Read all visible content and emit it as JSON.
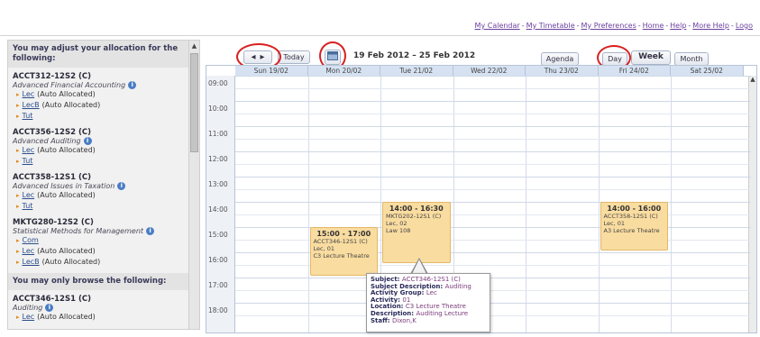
{
  "toplinks": [
    {
      "label": "My Calendar"
    },
    {
      "label": "My Timetable"
    },
    {
      "label": "My Preferences"
    },
    {
      "label": "Home"
    },
    {
      "label": "Help"
    },
    {
      "label": "More Help"
    },
    {
      "label": "Logo"
    }
  ],
  "sidebar": {
    "heading_adjust": "You may adjust your allocation for the following:",
    "heading_browse": "You may only browse the following:",
    "courses": [
      {
        "code": "ACCT312-12S2 (C)",
        "desc": "Advanced Financial Accounting",
        "acts": [
          {
            "link": "Lec",
            "note": "(Auto Allocated)"
          },
          {
            "link": "LecB",
            "note": "(Auto Allocated)"
          },
          {
            "link": "Tut",
            "note": ""
          }
        ]
      },
      {
        "code": "ACCT356-12S2 (C)",
        "desc": "Advanced Auditing",
        "acts": [
          {
            "link": "Lec",
            "note": "(Auto Allocated)"
          },
          {
            "link": "Tut",
            "note": ""
          }
        ]
      },
      {
        "code": "ACCT358-12S1 (C)",
        "desc": "Advanced Issues in Taxation",
        "acts": [
          {
            "link": "Lec",
            "note": "(Auto Allocated)"
          },
          {
            "link": "Tut",
            "note": ""
          }
        ]
      },
      {
        "code": "MKTG280-12S2 (C)",
        "desc": "Statistical Methods for Management",
        "acts": [
          {
            "link": "Com",
            "note": ""
          },
          {
            "link": "Lec",
            "note": "(Auto Allocated)"
          },
          {
            "link": "LecB",
            "note": "(Auto Allocated)"
          }
        ]
      }
    ],
    "browse_courses": [
      {
        "code": "ACCT346-12S1 (C)",
        "desc": "Auditing",
        "acts": [
          {
            "link": "Lec",
            "note": "(Auto Allocated)"
          }
        ]
      }
    ]
  },
  "toolbar": {
    "prev": "◀",
    "next": "▶",
    "today": "Today",
    "range": "19 Feb 2012 – 25 Feb 2012",
    "agenda": "Agenda",
    "day": "Day",
    "week": "Week",
    "month": "Month"
  },
  "days": [
    "Sun 19/02",
    "Mon 20/02",
    "Tue 21/02",
    "Wed 22/02",
    "Thu 23/02",
    "Fri 24/02",
    "Sat 25/02"
  ],
  "times": [
    "09:00",
    "10:00",
    "11:00",
    "12:00",
    "13:00",
    "14:00",
    "15:00",
    "16:00",
    "17:00",
    "18:00"
  ],
  "events": [
    {
      "time": "14:00 - 16:30",
      "lines": [
        "MKTG202-12S1 (C)",
        "Lec, 02",
        "Law 108"
      ],
      "day_index": 2,
      "start": 14.0,
      "end": 16.5
    },
    {
      "time": "15:00 - 17:00",
      "lines": [
        "ACCT346-12S1 (C)",
        "Lec, 01",
        "C3 Lecture Theatre"
      ],
      "day_index": 1,
      "start": 15.0,
      "end": 17.0
    },
    {
      "time": "14:00 - 16:00",
      "lines": [
        "ACCT358-12S1 (C)",
        "Lec, 01",
        "A3 Lecture Theatre"
      ],
      "day_index": 5,
      "start": 14.0,
      "end": 16.0
    }
  ],
  "tooltip": [
    {
      "k": "Subject:",
      "v": "ACCT346-12S1 (C)"
    },
    {
      "k": "Subject Description:",
      "v": "Auditing"
    },
    {
      "k": "Activity Group:",
      "v": "Lec"
    },
    {
      "k": "Activity:",
      "v": "01"
    },
    {
      "k": "Location:",
      "v": "C3 Lecture Theatre"
    },
    {
      "k": "Description:",
      "v": "Auditing Lecture"
    },
    {
      "k": "Staff:",
      "v": "Dixon,K"
    }
  ],
  "colors": {
    "event_bg": "#f9dca0",
    "header_bg": "#d6e2f2",
    "annotation": "#d92020",
    "link": "#6b3fa0"
  }
}
